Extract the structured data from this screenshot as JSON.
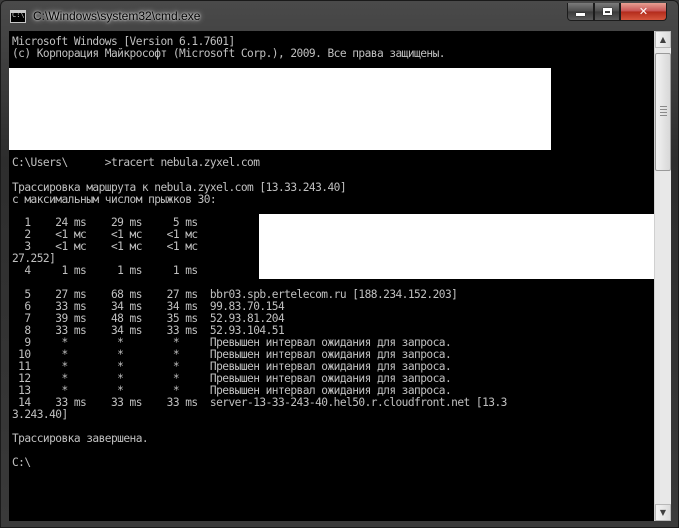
{
  "window": {
    "title": "C:\\Windows\\system32\\cmd.exe",
    "icon_text": "C:\\"
  },
  "console": {
    "lines": [
      "Microsoft Windows [Version 6.1.7601]",
      "(c) Корпорация Майкрософт (Microsoft Corp.), 2009. Все права защищены.",
      "C:\\Users\\      >tracert nebula.zyxel.com",
      "Трассировка маршрута к nebula.zyxel.com [13.33.243.40]",
      "с максимальным числом прыжков 30:",
      "  1    24 ms    29 ms     5 ms",
      "  2    <1 мс    <1 мс    <1 мс",
      "  3    <1 мс    <1 мс    <1 мс",
      "27.252]",
      "  4     1 ms     1 ms     1 ms",
      "  5    27 ms    68 ms    27 ms  bbr03.spb.ertelecom.ru [188.234.152.203]",
      "  6    33 ms    34 ms    34 ms  99.83.70.154",
      "  7    39 ms    48 ms    35 ms  52.93.81.204",
      "  8    33 ms    34 ms    33 ms  52.93.104.51",
      "  9     *        *        *     Превышен интервал ожидания для запроса.",
      " 10     *        *        *     Превышен интервал ожидания для запроса.",
      " 11     *        *        *     Превышен интервал ожидания для запроса.",
      " 12     *        *        *     Превышен интервал ожидания для запроса.",
      " 13     *        *        *     Превышен интервал ожидания для запроса.",
      " 14    33 ms    33 ms    33 ms  server-13-33-243-40.hel50.r.cloudfront.net [13.3",
      "3.243.40]",
      "Трассировка завершена.",
      "C:\\"
    ]
  },
  "colors": {
    "console_bg": "#000000",
    "console_fg": "#c0c0c0",
    "close_button": "#c75050"
  }
}
